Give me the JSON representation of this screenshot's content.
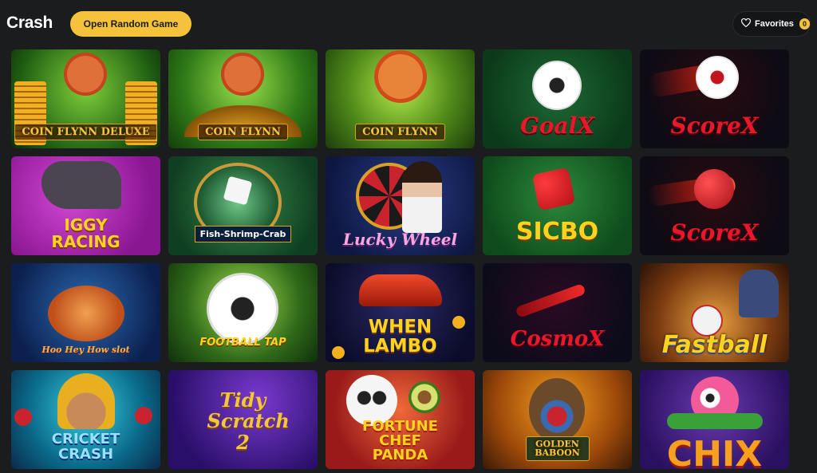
{
  "header": {
    "title": "Crash",
    "random_button": "Open Random Game",
    "favorites_label": "Favorites",
    "favorites_count": "0",
    "favorites_icon": "heart-icon"
  },
  "games": [
    {
      "title": "COIN FLYNN DELUXE"
    },
    {
      "title": "COIN FLYNN"
    },
    {
      "title": "COIN FLYNN"
    },
    {
      "title": "GoalX"
    },
    {
      "title": "ScoreX"
    },
    {
      "title": "IGGY RACING"
    },
    {
      "title": "Fish-Shrimp-Crab"
    },
    {
      "title": "Lucky Wheel"
    },
    {
      "title": "SICBO"
    },
    {
      "title": "ScoreX"
    },
    {
      "title": "Hoo Hey How slot"
    },
    {
      "title": "FOOTBALL TAP"
    },
    {
      "title": "WHEN LAMBO"
    },
    {
      "title": "CosmoX"
    },
    {
      "title": "Fastball"
    },
    {
      "title": "CRICKET CRASH"
    },
    {
      "title": "Tidy Scratch 2"
    },
    {
      "title": "FORTUNE CHEF PANDA"
    },
    {
      "title": "GOLDEN BABOON"
    },
    {
      "title": "CHIX"
    }
  ]
}
